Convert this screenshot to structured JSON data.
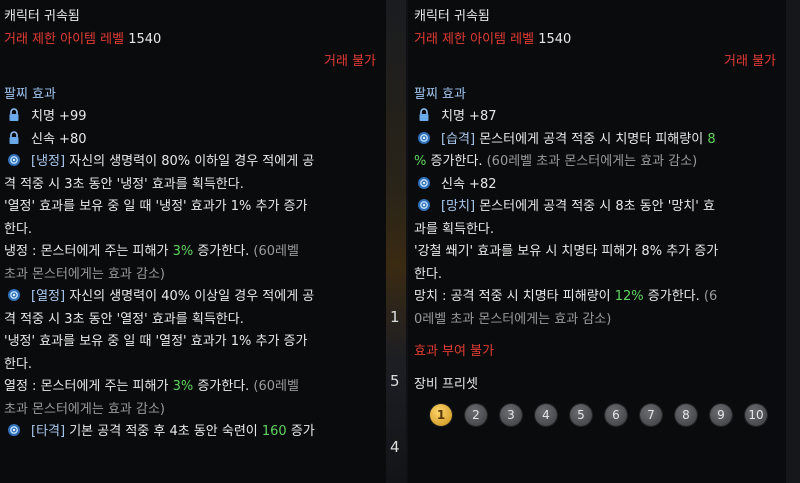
{
  "left": {
    "bound": "캐릭터 귀속됨",
    "level_label": "거래 제한 아이템 레벨",
    "level_value": "1540",
    "trade": "거래 불가",
    "section": "팔찌 효과",
    "stat1": "치명 +99",
    "stat2": "신속 +80",
    "e1_tag": "[냉정]",
    "e1_l1": " 자신의 생명력이 80% 이하일 경우 적에게 공",
    "e1_l2": "격 적중 시 3초 동안 '냉정' 효과를 획득한다.",
    "e1_l3": "'열정' 효과를 보유 중 일 때 '냉정' 효과가 1% 추가 증가",
    "e1_l4": "한다.",
    "e1_l5a": "냉정 : 몬스터에게 주는 피해가 ",
    "e1_l5b": "3%",
    "e1_l5c": " 증가한다.",
    "e1_l5d": " (60레벨",
    "e1_l6": "초과 몬스터에게는 효과 감소)",
    "e2_tag": "[열정]",
    "e2_l1": " 자신의 생명력이 40% 이상일 경우 적에게 공",
    "e2_l2": "격 적중 시 3초 동안 '열정' 효과를 획득한다.",
    "e2_l3": "'냉정' 효과를 보유 중 일 때 '열정' 효과가 1% 추가 증가",
    "e2_l4": "한다.",
    "e2_l5a": "열정 : 몬스터에게 주는 피해가 ",
    "e2_l5b": "3%",
    "e2_l5c": " 증가한다.",
    "e2_l5d": " (60레벨",
    "e2_l6": "초과 몬스터에게는 효과 감소)",
    "e3_tag": "[타격]",
    "e3_l1a": " 기본 공격 적중 후 4초 동안 숙련이 ",
    "e3_l1b": "160",
    "e3_l1c": " 증가"
  },
  "right": {
    "bound": "캐릭터 귀속됨",
    "level_label": "거래 제한 아이템 레벨",
    "level_value": "1540",
    "trade": "거래 불가",
    "section": "팔찌 효과",
    "stat1": "치명 +87",
    "e1_tag": "[습격]",
    "e1_l1a": " 몬스터에게 공격 적중 시 치명타 피해량이 ",
    "e1_l1b": "8",
    "e1_l2a": "%",
    "e1_l2b": " 증가한다.",
    "e1_l2c": " (60레벨 초과 몬스터에게는 효과 감소)",
    "stat2": "신속 +82",
    "e2_tag": "[망치]",
    "e2_l1": " 몬스터에게 공격 적중 시 8초 동안 '망치' 효",
    "e2_l2": "과를 획득한다.",
    "e2_l3": "'강철 쐐기' 효과를 보유 시 치명타 피해가 8% 추가 증가",
    "e2_l4": "한다.",
    "e2_l5a": "망치 : 공격 적중 시 치명타 피해량이 ",
    "e2_l5b": "12%",
    "e2_l5c": " 증가한다.",
    "e2_l5d": " (6",
    "e2_l6": "0레벨 초과 몬스터에게는 효과 감소)",
    "no_enchant": "효과 부여 불가",
    "preset_title": "장비 프리셋",
    "presets": [
      "1",
      "2",
      "3",
      "4",
      "5",
      "6",
      "7",
      "8",
      "9",
      "10"
    ],
    "preset_active": "1"
  },
  "background_numbers": [
    "1",
    "5",
    "4"
  ],
  "icons": {
    "stat": "lock-icon",
    "effect": "swirl-gem-icon"
  }
}
